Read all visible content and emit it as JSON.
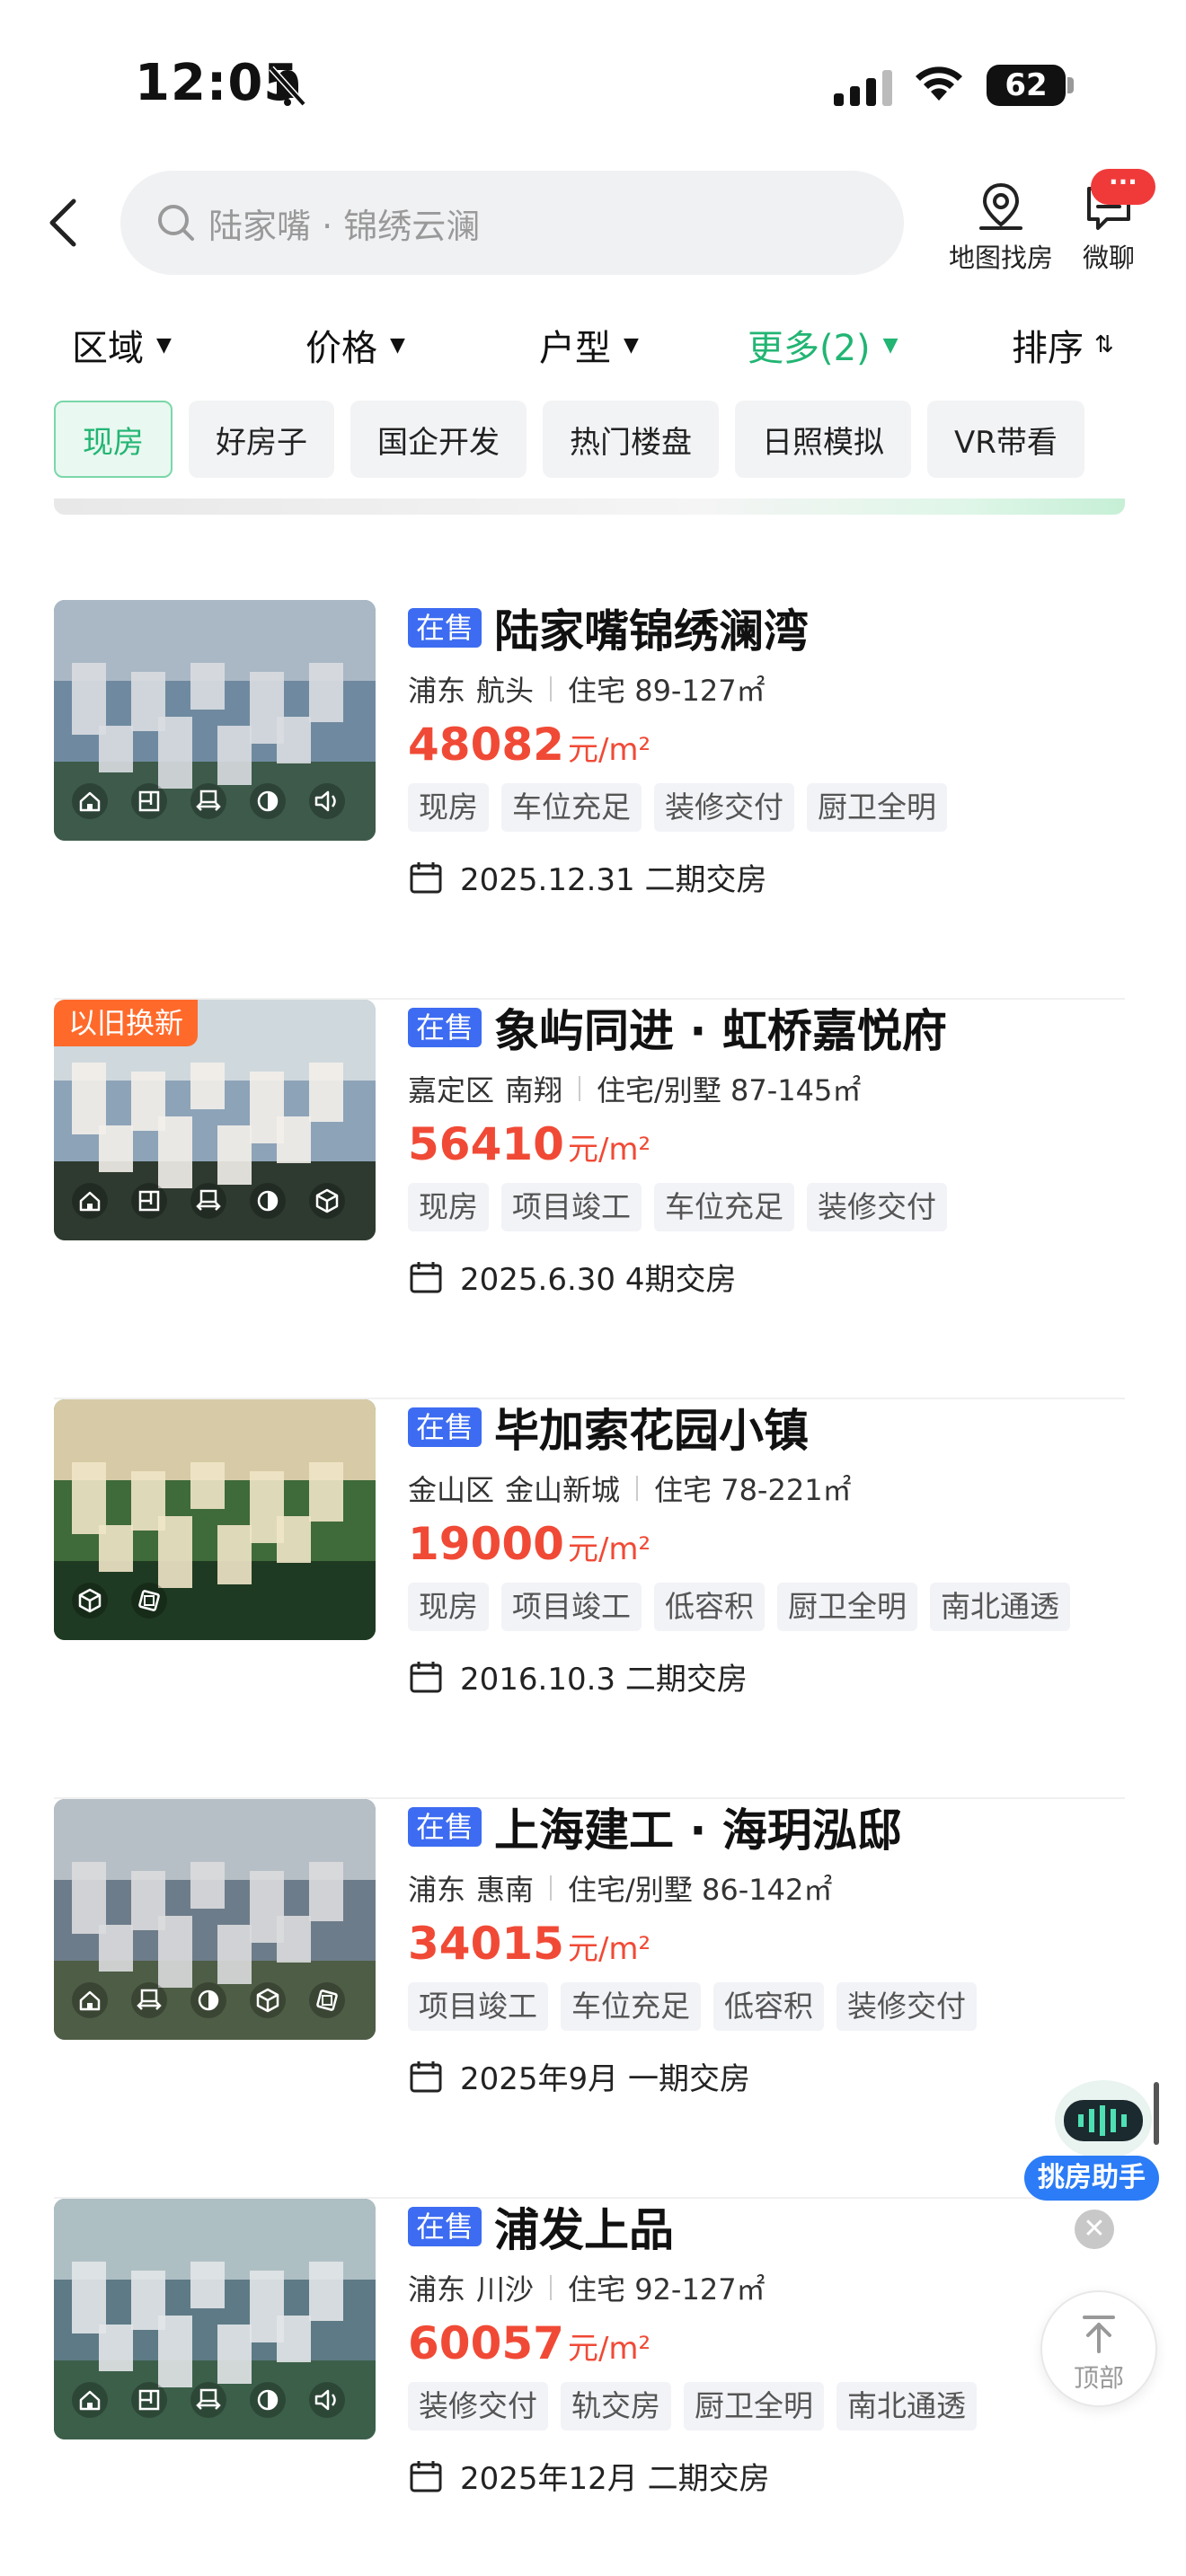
{
  "status_bar": {
    "time": "12:05",
    "battery": "62"
  },
  "search": {
    "placeholder": "陆家嘴 · 锦绣云澜"
  },
  "header": {
    "map_label": "地图找房",
    "chat_label": "微聊",
    "chat_badge": "···"
  },
  "filters": [
    {
      "label": "区域",
      "active": false
    },
    {
      "label": "价格",
      "active": false
    },
    {
      "label": "户型",
      "active": false
    },
    {
      "label": "更多(2)",
      "active": true
    },
    {
      "label": "排序",
      "active": false
    }
  ],
  "chips": [
    "现房",
    "好房子",
    "国企开发",
    "热门楼盘",
    "日照模拟",
    "VR带看"
  ],
  "listings": [
    {
      "status": "在售",
      "name": "陆家嘴锦绣澜湾",
      "district": "浦东",
      "area": "航头",
      "type": "住宅 89-127㎡",
      "price": "48082",
      "price_unit": "元/m²",
      "tags": [
        "现房",
        "车位充足",
        "装修交付",
        "厨卫全明"
      ],
      "delivery": "2025.12.31 二期交房",
      "ribbon": "",
      "thumb_icons": [
        "home-icon",
        "floorplan-icon",
        "vr-tour-icon",
        "sunlight-icon",
        "audio-guide-icon"
      ]
    },
    {
      "status": "在售",
      "name": "象屿同进 · 虹桥嘉悦府",
      "district": "嘉定区",
      "area": "南翔",
      "type": "住宅/别墅 87-145㎡",
      "price": "56410",
      "price_unit": "元/m²",
      "tags": [
        "现房",
        "项目竣工",
        "车位充足",
        "装修交付"
      ],
      "delivery": "2025.6.30 4期交房",
      "ribbon": "以旧换新",
      "thumb_icons": [
        "home-icon",
        "floorplan-icon",
        "vr-tour-icon",
        "sunlight-icon",
        "3d-model-icon"
      ]
    },
    {
      "status": "在售",
      "name": "毕加索花园小镇",
      "district": "金山区",
      "area": "金山新城",
      "type": "住宅 78-221㎡",
      "price": "19000",
      "price_unit": "元/m²",
      "tags": [
        "现房",
        "项目竣工",
        "低容积",
        "厨卫全明",
        "南北通透"
      ],
      "delivery": "2016.10.3 二期交房",
      "ribbon": "",
      "thumb_icons": [
        "3d-model-icon",
        "sandbox-icon"
      ]
    },
    {
      "status": "在售",
      "name": "上海建工 · 海玥泓邸",
      "district": "浦东",
      "area": "惠南",
      "type": "住宅/别墅 86-142㎡",
      "price": "34015",
      "price_unit": "元/m²",
      "tags": [
        "项目竣工",
        "车位充足",
        "低容积",
        "装修交付"
      ],
      "delivery": "2025年9月 一期交房",
      "ribbon": "",
      "thumb_icons": [
        "home-icon",
        "vr-tour-icon",
        "sunlight-icon",
        "3d-model-icon",
        "sandbox-icon"
      ]
    },
    {
      "status": "在售",
      "name": "浦发上品",
      "district": "浦东",
      "area": "川沙",
      "type": "住宅 92-127㎡",
      "price": "60057",
      "price_unit": "元/m²",
      "tags": [
        "装修交付",
        "轨交房",
        "厨卫全明",
        "南北通透"
      ],
      "delivery": "2025年12月 二期交房",
      "ribbon": "",
      "thumb_icons": [
        "home-icon",
        "floorplan-icon",
        "vr-tour-icon",
        "sunlight-icon",
        "audio-guide-icon"
      ]
    }
  ],
  "floating": {
    "assistant_label": "挑房助手",
    "top_label": "顶部"
  },
  "colors": {
    "accent_green": "#22b573",
    "price_red": "#f04a36",
    "sale_blue": "#3d6cf2",
    "ribbon_orange": "#ff6a2b"
  }
}
